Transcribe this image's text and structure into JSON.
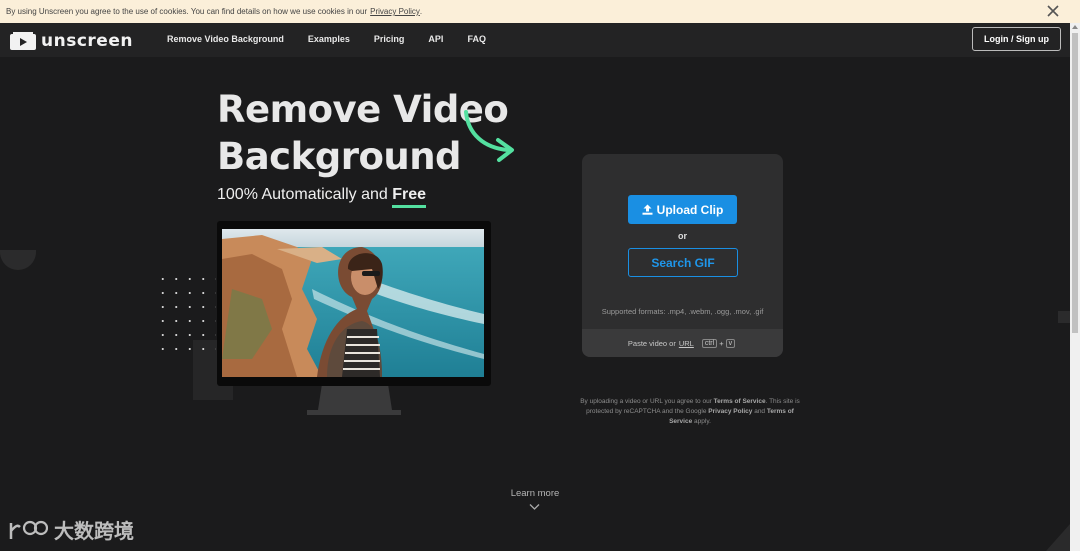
{
  "cookie": {
    "text": "By using Unscreen you agree to the use of cookies. You can find details on how we use cookies in our",
    "link": "Privacy Policy",
    "suffix": "."
  },
  "nav": {
    "brand": "unscreen",
    "links": [
      "Remove Video Background",
      "Examples",
      "Pricing",
      "API",
      "FAQ"
    ],
    "login": "Login / Sign up"
  },
  "hero": {
    "title_line1": "Remove Video",
    "title_line2": "Background",
    "subtitle_prefix": "100% Automatically and",
    "subtitle_emphasis": "Free"
  },
  "upload": {
    "upload_label": "Upload Clip",
    "or": "or",
    "search_label": "Search GIF",
    "formats": "Supported formats: .mp4, .webm, .ogg, .mov, .gif",
    "paste_prefix": "Paste video or",
    "paste_link": "URL",
    "key_ctrl": "ctrl",
    "key_plus": "+",
    "key_v": "v"
  },
  "legal": {
    "part1": "By uploading a video or URL you agree to our",
    "tos1": "Terms of Service",
    "part2": ". This site is protected by reCAPTCHA and the Google",
    "privacy": "Privacy Policy",
    "part3": "and",
    "tos2": "Terms of Service",
    "part4": "apply."
  },
  "learn_more": "Learn more",
  "watermark": "大数跨境",
  "colors": {
    "accent_blue": "#1a8fe3",
    "accent_green": "#54e0a0",
    "background": "#1b1b1c",
    "cookie_bg": "#fbefd9"
  },
  "icons": [
    "close-icon",
    "logo-icon",
    "arrow-deco-icon",
    "upload-icon",
    "chevron-down-icon"
  ]
}
